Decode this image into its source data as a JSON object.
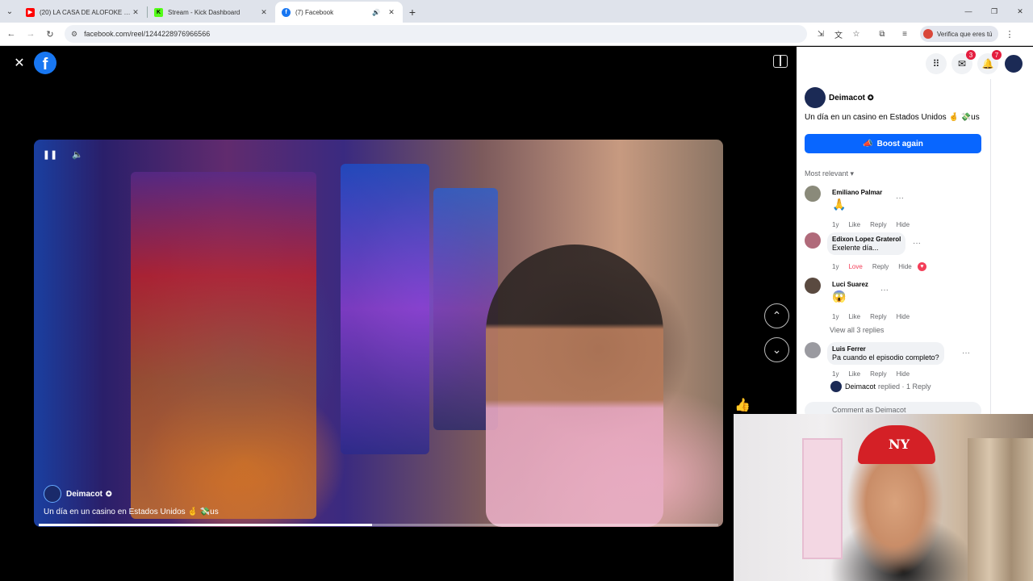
{
  "browser": {
    "tabs": [
      {
        "title": "(20) LA CASA DE ALOFOKE 2 (",
        "favicon_color": "#ff0000"
      },
      {
        "title": "Stream - Kick Dashboard",
        "favicon_color": "#53fc18"
      },
      {
        "title": "(7) Facebook",
        "favicon_color": "#1877f2"
      }
    ],
    "url": "facebook.com/reel/1244228976966566",
    "verify_label": "Verifica que eres tú"
  },
  "viewer": {
    "video": {
      "author": "Deimacot",
      "caption": "Un día en un casino en Estados Unidos 🤞 💸us",
      "progress": 0.49
    }
  },
  "topnav": {
    "messenger_badge": "3",
    "notifications_badge": "7"
  },
  "post": {
    "author": "Deimacot",
    "caption": "Un día en un casino en Estados Unidos 🤞 💸us",
    "boost_label": "Boost again",
    "sort_label": "Most relevant",
    "comments": [
      {
        "name": "Emiliano Palmar",
        "text": "🙏",
        "time": "1y",
        "like": "Like",
        "reply": "Reply",
        "hide": "Hide"
      },
      {
        "name": "Edixon Lopez Graterol",
        "text": "Exelente día...",
        "time": "1y",
        "like": "Love",
        "reply": "Reply",
        "hide": "Hide"
      },
      {
        "name": "Luci Suarez",
        "text": "😱",
        "time": "1y",
        "like": "Like",
        "reply": "Reply",
        "hide": "Hide"
      },
      {
        "name": "Luis Ferrer",
        "text": "Pa cuando el episodio completo?",
        "time": "1y",
        "like": "Like",
        "reply": "Reply",
        "hide": "Hide"
      }
    ],
    "view_replies": "View all 3 replies",
    "replied_author": "Deimacot",
    "replied_text": "replied · 1 Reply",
    "comment_placeholder": "Comment as Deimacot"
  },
  "colors": {
    "accent": "#0866ff",
    "brand": "#1877f2",
    "love": "#f33e58"
  }
}
